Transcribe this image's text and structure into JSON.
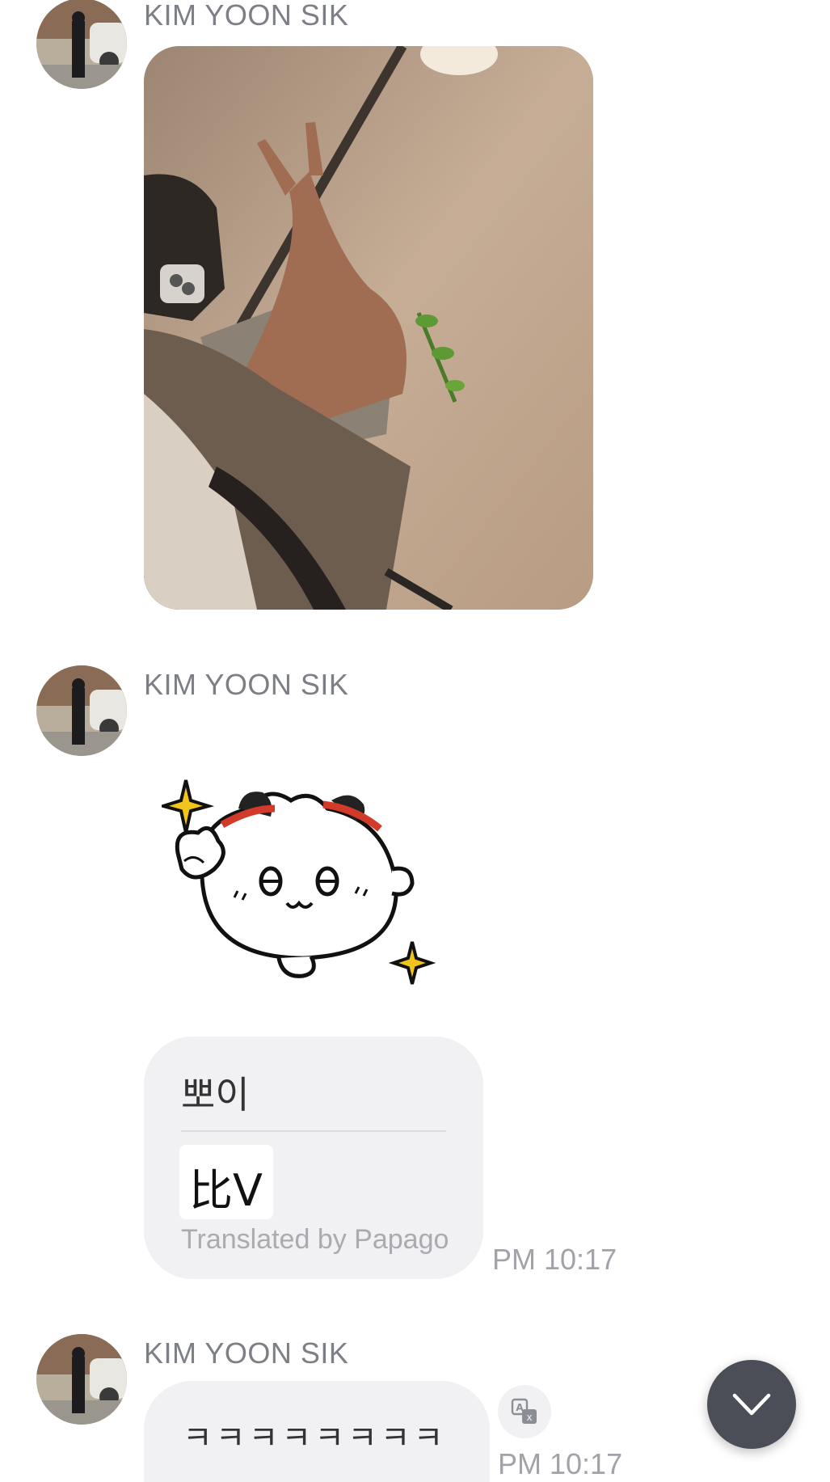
{
  "messages": [
    {
      "sender": "KIM YOON SIK",
      "type": "photo"
    },
    {
      "sender": "KIM YOON SIK",
      "type": "sticker"
    },
    {
      "type": "translated-text",
      "original": "뽀이",
      "translated": "比V",
      "translation_credit": "Translated by Papago",
      "time": "PM 10:17"
    },
    {
      "sender": "KIM YOON SIK",
      "type": "text",
      "text": "ㅋㅋㅋㅋㅋㅋㅋㅋ",
      "time": "PM 10:17"
    }
  ],
  "icons": {
    "translate": "translate-icon",
    "scroll_down": "chevron-down-icon"
  },
  "colors": {
    "bubble": "#f1f1f3",
    "scroll_button": "#4b4e57",
    "sender_name": "#7d7f86",
    "time": "#a1a3a9"
  }
}
